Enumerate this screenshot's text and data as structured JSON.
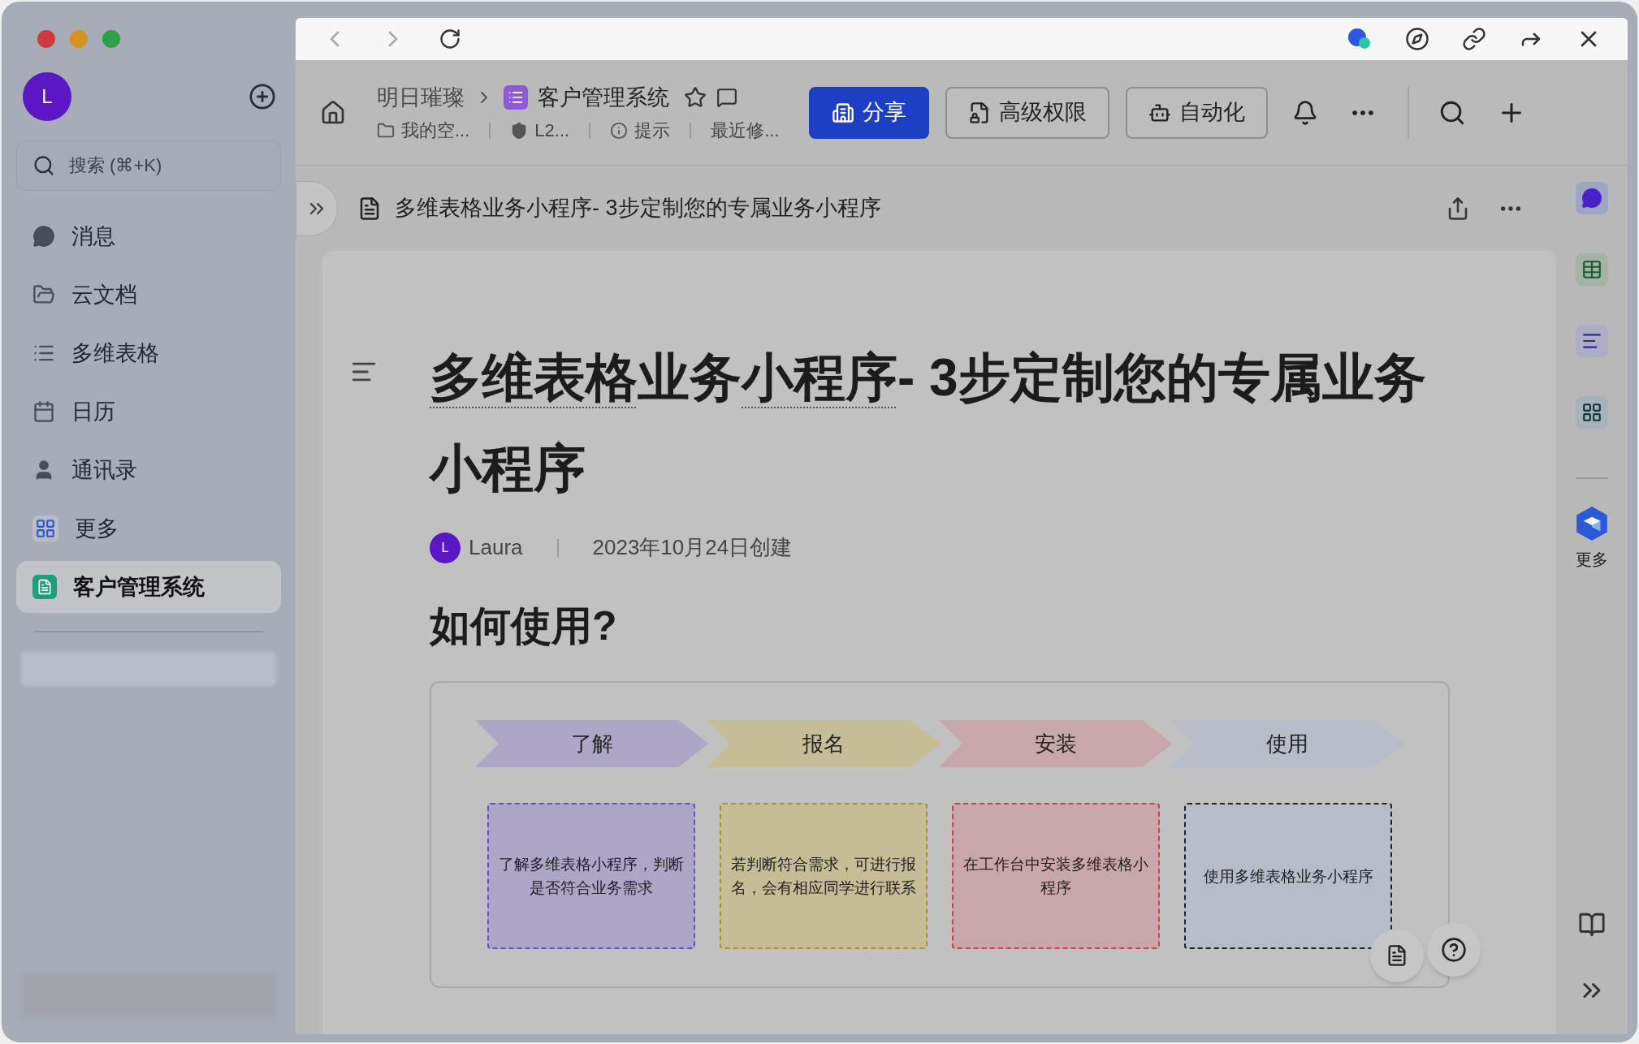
{
  "sidebar": {
    "avatar": "L",
    "search": {
      "placeholder": "搜索 (⌘+K)"
    },
    "items": [
      {
        "label": "消息",
        "selected": false
      },
      {
        "label": "云文档",
        "selected": false
      },
      {
        "label": "多维表格",
        "selected": false
      },
      {
        "label": "日历",
        "selected": false
      },
      {
        "label": "通讯录",
        "selected": false
      },
      {
        "label": "更多",
        "selected": false
      },
      {
        "label": "客户管理系统",
        "selected": true
      }
    ]
  },
  "toolbar": {
    "breadcrumb": [
      "明日璀璨",
      "客户管理系统"
    ],
    "meta": [
      "我的空...",
      "L2...",
      "提示",
      "最近修..."
    ],
    "buttons": [
      {
        "label": "分享",
        "kind": "primary"
      },
      {
        "label": "高级权限",
        "kind": "outline"
      },
      {
        "label": "自动化",
        "kind": "outline"
      }
    ]
  },
  "doc_header": {
    "title": "多维表格业务小程序- 3步定制您的专属业务小程序"
  },
  "document": {
    "title_parts": [
      {
        "text": "多维表格",
        "linked": true
      },
      {
        "text": "业务",
        "linked": false
      },
      {
        "text": "小程序",
        "linked": true
      },
      {
        "text": "- 3步定制您的专属业务小程序",
        "linked": false
      }
    ],
    "author": {
      "initial": "L",
      "name": "Laura"
    },
    "created": "2023年10月24日创建",
    "heading": "如何使用?",
    "steps": [
      {
        "label": "了解",
        "color": "#aea6c6",
        "card": {
          "text": "了解多维表格小程序，判断是否符合业务需求",
          "color": "#6b4fc0"
        }
      },
      {
        "label": "报名",
        "color": "#c6bc95",
        "card": {
          "text": "若判断符合需求，可进行报名，会有相应同学进行联系",
          "color": "#a8913e"
        }
      },
      {
        "label": "安装",
        "color": "#c7a7a9",
        "card": {
          "text": "在工作台中安装多维表格小程序",
          "color": "#c0464f"
        }
      },
      {
        "label": "使用",
        "color": "#b7bcc8",
        "card": {
          "text": "使用多维表格业务小程序",
          "color": "#222222"
        }
      }
    ]
  },
  "right_rail": {
    "more_label": "更多"
  }
}
